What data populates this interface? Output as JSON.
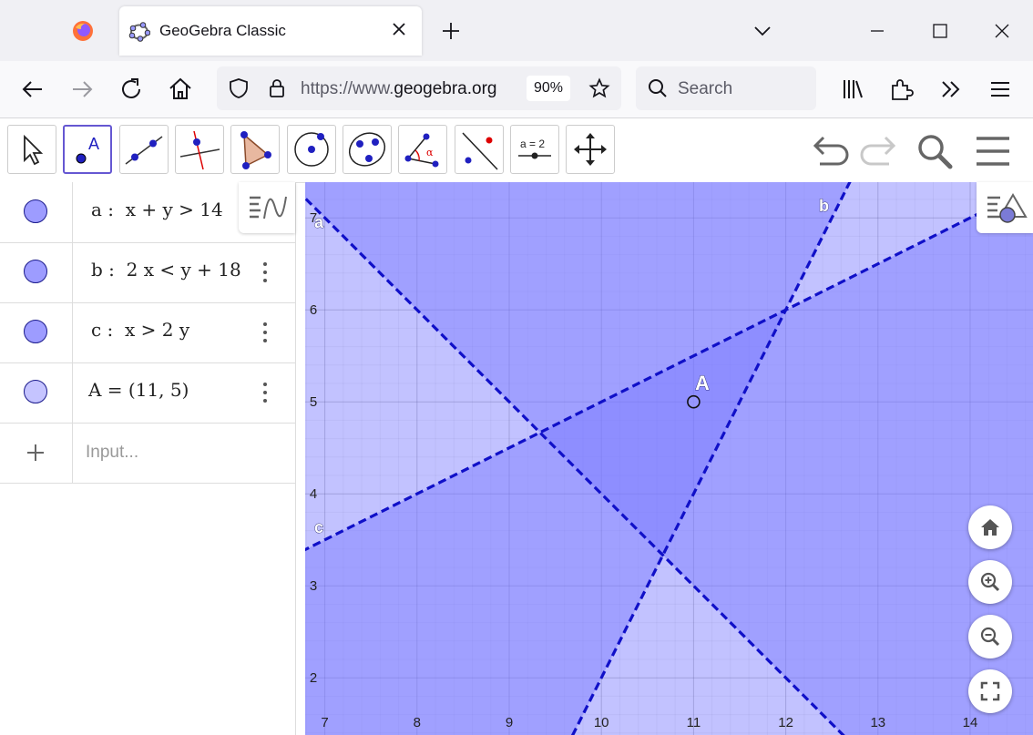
{
  "browser": {
    "tab_title": "GeoGebra Classic",
    "url_prefix": "https://www.",
    "url_domain": "geogebra.org",
    "zoom": "90%",
    "search_placeholder": "Search"
  },
  "algebra": {
    "items": [
      {
        "expr": "a :  x + y > 14",
        "color": "#9d9cff"
      },
      {
        "expr": "b :  2 x < y + 18",
        "color": "#9d9cff"
      },
      {
        "expr": "c :  x > 2 y",
        "color": "#9d9cff"
      },
      {
        "expr": "A = (11, 5)",
        "color": "#c5c4ff"
      }
    ],
    "input_placeholder": "Input..."
  },
  "graphics": {
    "x_ticks": [
      "7",
      "8",
      "9",
      "10",
      "11",
      "12",
      "13",
      "14"
    ],
    "y_ticks": [
      "2",
      "3",
      "4",
      "5",
      "6",
      "7"
    ],
    "line_labels": [
      "a",
      "b",
      "c"
    ],
    "point_label": "A",
    "region_color": "#7878ff",
    "line_color": "#1010c8"
  }
}
